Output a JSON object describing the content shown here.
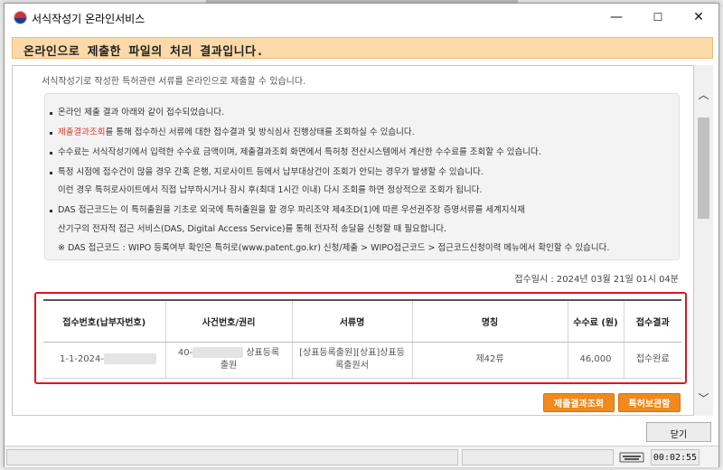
{
  "window": {
    "title": "서식작성기 온라인서비스",
    "minimize": "—",
    "maximize": "☐",
    "close": "✕"
  },
  "banner": {
    "text": "온라인으로 제출한 파일의 처리 결과입니다."
  },
  "cut_text": "서식작성기로 작성한 특허관련 서류를 온라인으로 제출할 수 있습니다.",
  "info": {
    "line1": "온라인 제출 결과 아래와 같이 접수되었습니다.",
    "line2_link": "제출결과조회",
    "line2_rest": "를 통해 접수하신 서류에 대한 접수결과 및 방식심사 진행상태를 조회하실 수 있습니다.",
    "line3": "수수료는 서식작성기에서 입력한 수수료 금액이며, 제출결과조회 화면에서 특허청 전산시스템에서 계산한 수수료를 조회할 수 있습니다.",
    "line4": "특정 시점에 접수건이 많을 경우 간혹 은행, 지로사이트 등에서 납부대상건이 조회가 안되는 경우가 발생할 수 있습니다.",
    "line5": "이런 경우 특허로사이트에서 직접 납부하시거나 잠시 후(최대 1시간 이내) 다시 조회를 하면 정상적으로 조회가 됩니다.",
    "line6": "DAS 접근코드는 이 특허출원을 기초로 외국에 특허출원을 할 경우 파리조약 제4조D(1)에 따른 우선권주장 증명서류를 세계지식재",
    "line7": "산기구의 전자적 접근 서비스(DAS, Digital Access Service)를 통해 전자적 송달을 신청할 때 필요합니다.",
    "line8": "※ DAS 접근코드 : WIPO 등록여부 확인은 특허로(www.patent.go.kr) 신청/제출 > WIPO접근코드 > 접근코드신청이력 메뉴에서 확인할 수 있습니다."
  },
  "timestamp": "접수일시 : 2024년 03월 21일 01시 04분",
  "table": {
    "headers": [
      "접수번호(납부자번호)",
      "사건번호/권리",
      "서류명",
      "명칭",
      "수수료 (원)",
      "접수결과"
    ],
    "row": {
      "receipt_no": "1-1-2024-",
      "case_no_prefix": "40-",
      "case_no_suffix": "상표등록",
      "case_no_line2": "출원",
      "doc_name": "[상표등록출원][상표]상표등록출원서",
      "title": "제42류",
      "fee": "46,000",
      "result": "접수완료"
    }
  },
  "buttons": {
    "submit_result": "제출결과조회",
    "patent_box": "특허보관함",
    "close": "닫기"
  },
  "scroll": {
    "up": "︿",
    "down": "﹀"
  },
  "status": {
    "timer": "00:02:55"
  }
}
